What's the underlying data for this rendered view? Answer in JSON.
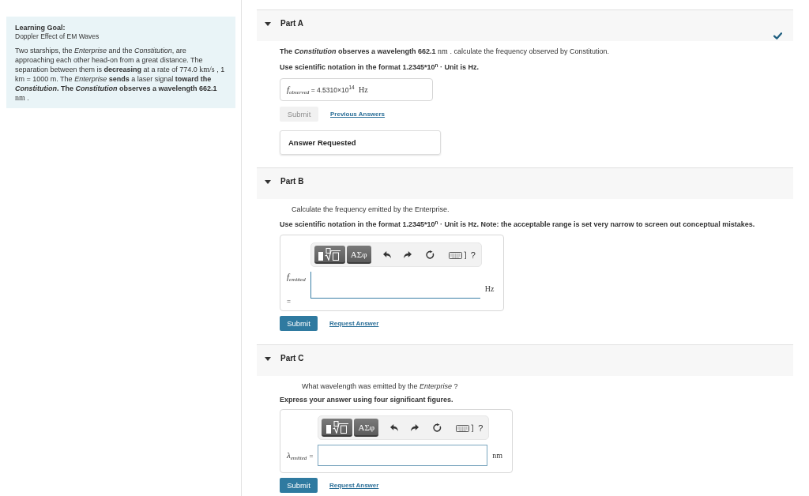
{
  "learning_goal": {
    "heading": "Learning Goal:",
    "subtitle": "Doppler Effect of EM Waves",
    "body": [
      {
        "kind": "text",
        "text": "Two starships, the *Enterprise* and the *Constitution*, are approaching each other head-on from a great distance. The separation between them is **decreasing** at a rate of 774.0 "
      },
      {
        "kind": "unit",
        "text": "km/s"
      },
      {
        "kind": "text",
        "text": " , 1 km = 1000 m.  The *Enterprise* **sends** a laser signal **toward the *Constitution*. The *Constitution* observes a wavelength 662.1** "
      },
      {
        "kind": "unit",
        "text": "nm"
      },
      {
        "kind": "text",
        "text": " ."
      }
    ]
  },
  "parts": [
    {
      "title": "Part A",
      "expanded": true,
      "completed": true,
      "question": {
        "indented": false,
        "segments": [
          {
            "kind": "text",
            "text": "**The *Constitution* observes a wavelength 662.1** "
          },
          {
            "kind": "unit",
            "text": "nm"
          },
          {
            "kind": "text",
            "text": " . calculate the frequency observed by Constitution."
          }
        ]
      },
      "instruction": "Use scientific notation in the format 1.2345*10$^{n}$ · Unit is Hz.",
      "answer": {
        "kind": "display",
        "symbol": "f",
        "subscript": "observed",
        "equals": "=",
        "value": "4.5310×10$^{14}$",
        "unit": "Hz"
      },
      "submit": {
        "label": "Submit",
        "disabled": true
      },
      "link": "Previous Answers",
      "feedback": "Answer Requested"
    },
    {
      "title": "Part B",
      "expanded": true,
      "completed": false,
      "question": {
        "indented": true,
        "segments": [
          {
            "kind": "text",
            "text": "Calculate the frequency emitted by the Enterprise."
          }
        ]
      },
      "instruction": "Use scientific notation in the format 1.2345*10$^{n}$ · Unit is Hz. Note: the acceptable range is set very narrow to screen out conceptual mistakes.",
      "answer": {
        "kind": "editor",
        "symbol": "f",
        "subscript": "emitted",
        "equals": "=",
        "unit": "Hz",
        "stacked": true,
        "focused": true,
        "toolbar": [
          {
            "kind": "templates"
          },
          {
            "kind": "symbols",
            "label": "ΑΣφ"
          },
          {
            "kind": "undo"
          },
          {
            "kind": "redo"
          },
          {
            "kind": "reset"
          },
          {
            "kind": "keyboard"
          },
          {
            "kind": "help",
            "label": "?"
          }
        ]
      },
      "submit": {
        "label": "Submit",
        "disabled": false
      },
      "link": "Request Answer"
    },
    {
      "title": "Part C",
      "expanded": true,
      "completed": false,
      "question": {
        "indented": true,
        "segments": [
          {
            "kind": "text",
            "text": "What wavelength was emitted by the *Enterprise* ?"
          }
        ]
      },
      "instruction": "Express your answer using four significant figures.",
      "answer": {
        "kind": "editor",
        "symbol": "λ",
        "subscript": "emitted",
        "equals": "=",
        "unit": "nm",
        "stacked": false,
        "focused": false,
        "toolbar": [
          {
            "kind": "templates"
          },
          {
            "kind": "symbols",
            "label": "ΑΣφ"
          },
          {
            "kind": "undo"
          },
          {
            "kind": "redo"
          },
          {
            "kind": "reset"
          },
          {
            "kind": "keyboard"
          },
          {
            "kind": "help",
            "label": "?"
          }
        ]
      },
      "submit": {
        "label": "Submit",
        "disabled": false
      },
      "link": "Request Answer"
    }
  ]
}
